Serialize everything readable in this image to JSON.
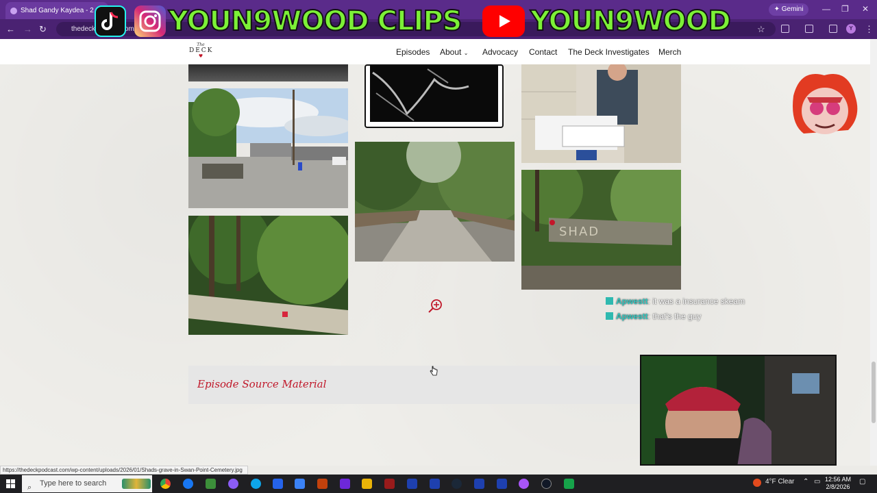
{
  "browser": {
    "tab_title": "Shad Gandy Kaydea - 2 of Spa",
    "gemini_label": "Gemini",
    "url": "thedeckpodcast.com/",
    "back_icon": "arrow-left-icon",
    "refresh_icon": "refresh-icon"
  },
  "overlay": {
    "left_text": "YOUN9WOOD CLIPS",
    "right_text": "YOUN9WOOD",
    "icons": [
      "tiktok-icon",
      "instagram-icon",
      "youtube-icon"
    ],
    "colors": {
      "text": "#7cf037",
      "instagram": "#d6249f",
      "youtube": "#ff0000",
      "tiktok": "#000000"
    }
  },
  "site": {
    "logo": {
      "small": "The",
      "big": "DECK"
    },
    "menu": {
      "episodes": "Episodes",
      "about": "About",
      "advocacy": "Advocacy",
      "contact": "Contact",
      "investigates": "The Deck Investigates",
      "merch": "Merch"
    },
    "source_title": "Episode Source Material",
    "accent_color": "#c0182a"
  },
  "chat": [
    {
      "user": "Apwestt",
      "message": ": it was a insurance skeam"
    },
    {
      "user": "Apwestt",
      "message": ": that's the guy"
    }
  ],
  "status_url": "https://thedeckpodcast.com/wp-content/uploads/2026/01/Shads-grave-in-Swan-Point-Cemetery.jpg",
  "taskbar": {
    "search_placeholder": "Type here to search",
    "weather": "4°F  Clear",
    "time": "12:56 AM",
    "date": "2/8/2026"
  }
}
